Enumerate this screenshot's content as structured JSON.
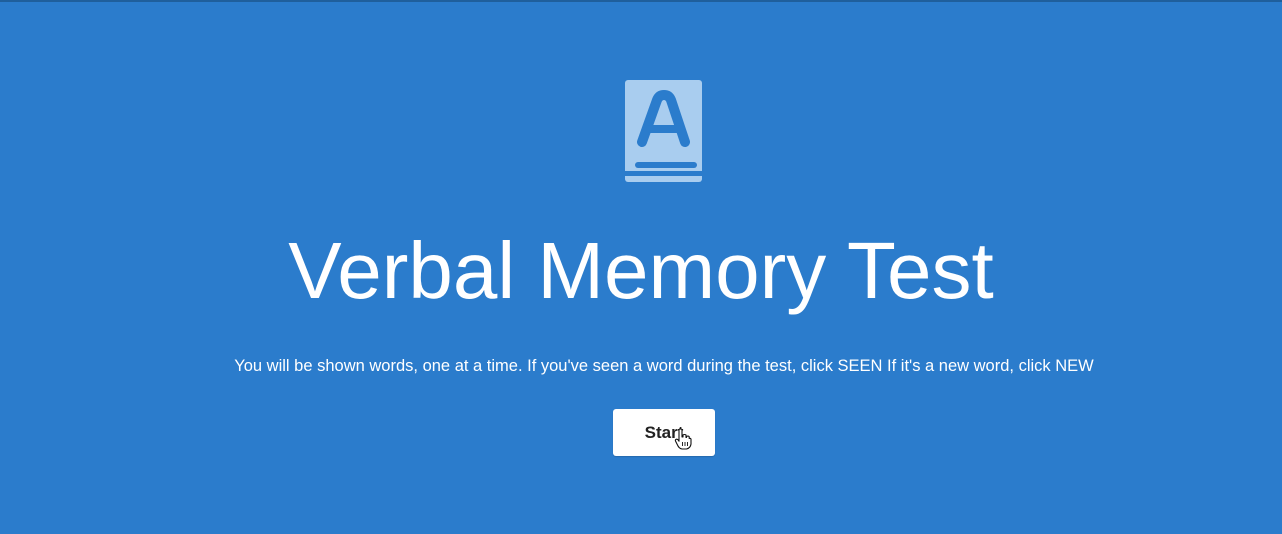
{
  "theme": {
    "background": "#2b7ccc",
    "icon_color": "#a9cdef",
    "button_bg": "#ffffff",
    "button_text": "#222222"
  },
  "hero": {
    "icon": "book-letter-a-icon",
    "title": "Verbal Memory Test",
    "instructions": "You will be shown words, one at a time. If you've seen a word during the test, click SEEN If it's a new word, click NEW",
    "start_label": "Start"
  },
  "pointer": {
    "icon": "hand-pointer-cursor-icon"
  }
}
